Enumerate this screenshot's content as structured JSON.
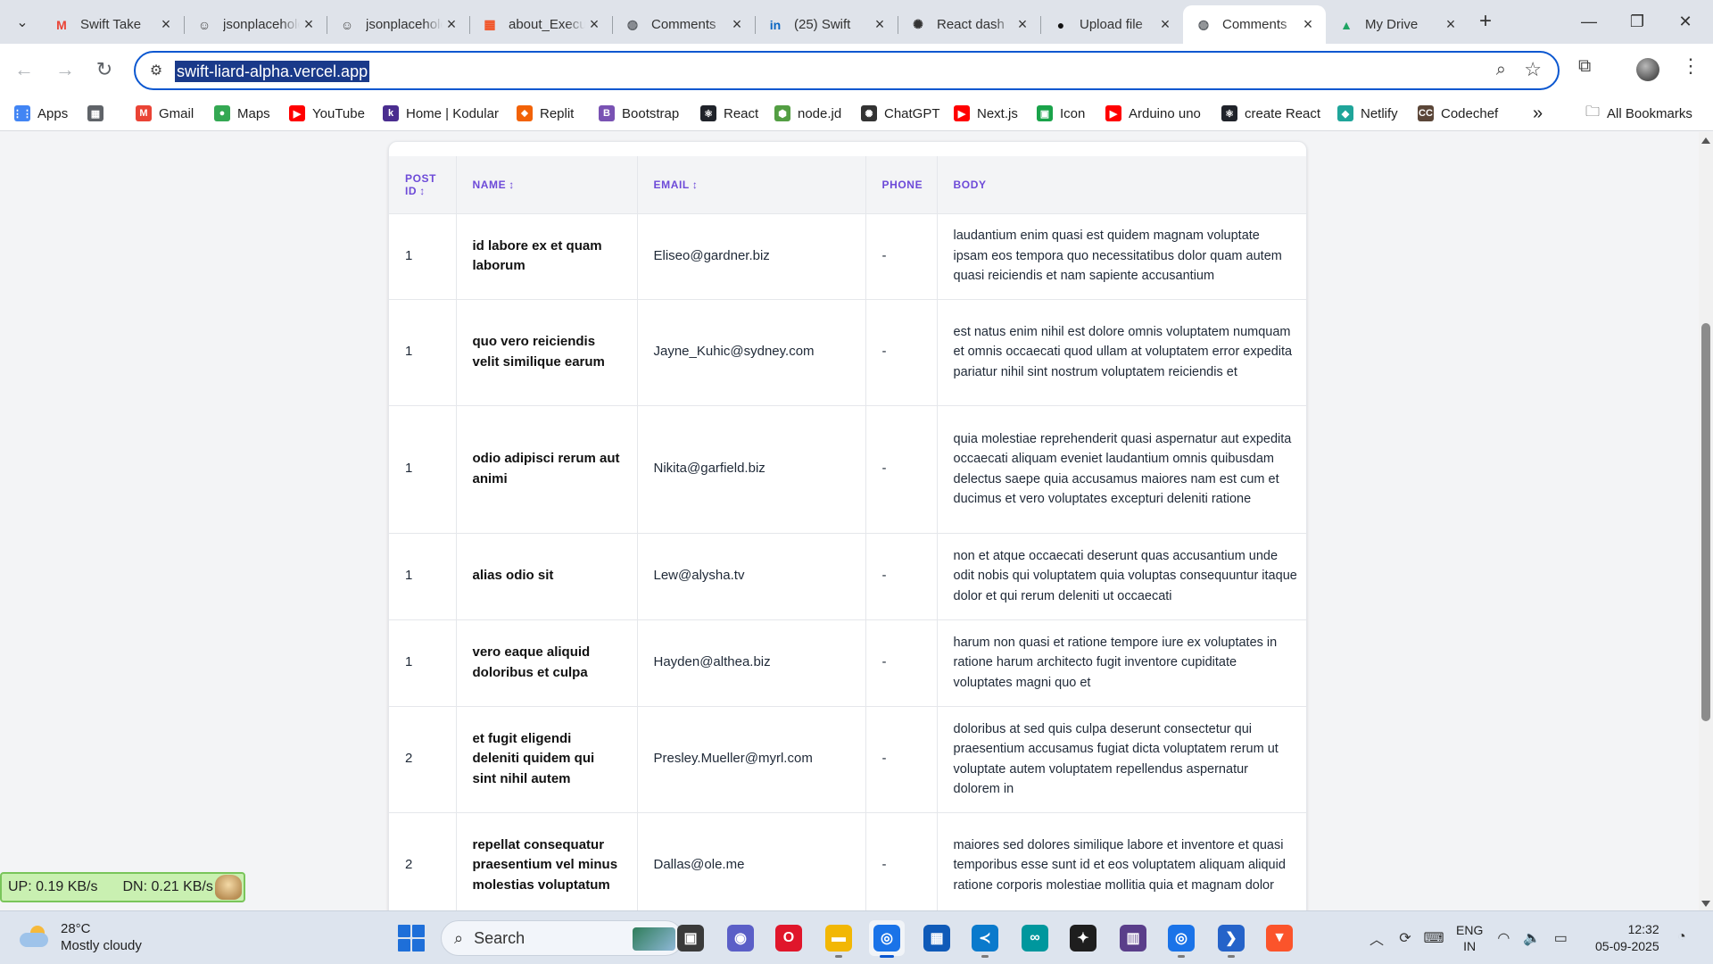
{
  "browser": {
    "tabs": [
      {
        "title": "Swift Take",
        "icon": "gmail-icon",
        "color": "#ea4335",
        "glyph": "M",
        "active": false
      },
      {
        "title": "jsonplaceholder",
        "icon": "jsonplaceholder-icon",
        "color": "#444444",
        "glyph": "☺",
        "active": false
      },
      {
        "title": "jsonplaceholder",
        "icon": "jsonplaceholder-icon",
        "color": "#444444",
        "glyph": "☺",
        "active": false
      },
      {
        "title": "about_Execution",
        "icon": "microsoft-icon",
        "color": "#f25022",
        "glyph": "▦",
        "active": false
      },
      {
        "title": "Comments",
        "icon": "globe-icon",
        "color": "#5f6368",
        "glyph": "◍",
        "active": false
      },
      {
        "title": "(25) Swift",
        "icon": "linkedin-icon",
        "color": "#0a66c2",
        "glyph": "in",
        "active": false
      },
      {
        "title": "React dash",
        "icon": "chatgpt-icon",
        "color": "#333333",
        "glyph": "✺",
        "active": false
      },
      {
        "title": "Upload file",
        "icon": "github-icon",
        "color": "#111111",
        "glyph": "●",
        "active": false
      },
      {
        "title": "Comments",
        "icon": "globe-icon",
        "color": "#5f6368",
        "glyph": "◍",
        "active": true
      },
      {
        "title": "My Drive",
        "icon": "google-drive-icon",
        "color": "#1fa463",
        "glyph": "▲",
        "active": false
      }
    ],
    "url": "swift-liard-alpha.vercel.app"
  },
  "bookmarks": [
    {
      "label": "Apps",
      "icon": "apps-grid-icon",
      "color": "#4285f4",
      "glyph": "⋮⋮"
    },
    {
      "label": "",
      "icon": "tab-groups-icon",
      "color": "#5f6368",
      "glyph": "▦"
    },
    {
      "label": "Gmail",
      "icon": "gmail-icon",
      "color": "#ea4335",
      "glyph": "M"
    },
    {
      "label": "Maps",
      "icon": "maps-pin-icon",
      "color": "#34a853",
      "glyph": "●"
    },
    {
      "label": "YouTube",
      "icon": "youtube-icon",
      "color": "#ff0000",
      "glyph": "▶"
    },
    {
      "label": "Home | Kodular",
      "icon": "kodular-icon",
      "color": "#4a2d8f",
      "glyph": "k"
    },
    {
      "label": "Replit",
      "icon": "replit-icon",
      "color": "#f26207",
      "glyph": "⬥"
    },
    {
      "label": "Bootstrap",
      "icon": "bootstrap-icon",
      "color": "#7952b3",
      "glyph": "B"
    },
    {
      "label": "React",
      "icon": "react-icon",
      "color": "#20232a",
      "glyph": "⚛"
    },
    {
      "label": "node.jd",
      "icon": "nodejs-icon",
      "color": "#539e43",
      "glyph": "⬢"
    },
    {
      "label": "ChatGPT",
      "icon": "chatgpt-icon",
      "color": "#333333",
      "glyph": "✺"
    },
    {
      "label": "Next.js",
      "icon": "youtube-icon",
      "color": "#ff0000",
      "glyph": "▶"
    },
    {
      "label": "Icon",
      "icon": "icon-site-icon",
      "color": "#1aa34a",
      "glyph": "▣"
    },
    {
      "label": "Arduino uno",
      "icon": "youtube-icon",
      "color": "#ff0000",
      "glyph": "▶"
    },
    {
      "label": "create React",
      "icon": "react-icon",
      "color": "#20232a",
      "glyph": "⚛"
    },
    {
      "label": "Netlify",
      "icon": "netlify-icon",
      "color": "#1fa59a",
      "glyph": "◆"
    },
    {
      "label": "Codechef",
      "icon": "codechef-icon",
      "color": "#5b4638",
      "glyph": "CC"
    }
  ],
  "bookmarks_more": "»",
  "all_bookmarks": "All Bookmarks",
  "table": {
    "headers": [
      {
        "label": "Post ID",
        "sortable": true
      },
      {
        "label": "Name",
        "sortable": true
      },
      {
        "label": "Email",
        "sortable": true
      },
      {
        "label": "Phone",
        "sortable": false
      },
      {
        "label": "Body",
        "sortable": false
      }
    ],
    "sort_glyph": "↕",
    "rows": [
      {
        "post_id": "1",
        "name": "id labore ex et quam laborum",
        "email": "Eliseo@gardner.biz",
        "phone": "-",
        "body": "laudantium enim quasi est quidem magnam voluptate ipsam eos tempora quo necessitatibus dolor quam autem quasi reiciendis et nam sapiente accusantium"
      },
      {
        "post_id": "1",
        "name": "quo vero reiciendis velit similique earum",
        "email": "Jayne_Kuhic@sydney.com",
        "phone": "-",
        "body": "est natus enim nihil est dolore omnis voluptatem numquam et omnis occaecati quod ullam at voluptatem error expedita pariatur nihil sint nostrum voluptatem reiciendis et"
      },
      {
        "post_id": "1",
        "name": "odio adipisci rerum aut animi",
        "email": "Nikita@garfield.biz",
        "phone": "-",
        "body": "quia molestiae reprehenderit quasi aspernatur aut expedita occaecati aliquam eveniet laudantium omnis quibusdam delectus saepe quia accusamus maiores nam est cum et ducimus et vero voluptates excepturi deleniti ratione"
      },
      {
        "post_id": "1",
        "name": "alias odio sit",
        "email": "Lew@alysha.tv",
        "phone": "-",
        "body": "non et atque occaecati deserunt quas accusantium unde odit nobis qui voluptatem quia voluptas consequuntur itaque dolor et qui rerum deleniti ut occaecati"
      },
      {
        "post_id": "1",
        "name": "vero eaque aliquid doloribus et culpa",
        "email": "Hayden@althea.biz",
        "phone": "-",
        "body": "harum non quasi et ratione tempore iure ex voluptates in ratione harum architecto fugit inventore cupiditate voluptates magni quo et"
      },
      {
        "post_id": "2",
        "name": "et fugit eligendi deleniti quidem qui sint nihil autem",
        "email": "Presley.Mueller@myrl.com",
        "phone": "-",
        "body": "doloribus at sed quis culpa deserunt consectetur qui praesentium accusamus fugiat dicta voluptatem rerum ut voluptate autem voluptatem repellendus aspernatur dolorem in"
      },
      {
        "post_id": "2",
        "name": "repellat consequatur praesentium vel minus molestias voluptatum",
        "email": "Dallas@ole.me",
        "phone": "-",
        "body": "maiores sed dolores similique labore et inventore et quasi temporibus esse sunt id et eos voluptatem aliquam aliquid ratione corporis molestiae mollitia quia et magnam dolor"
      }
    ]
  },
  "netspeed": {
    "up": "UP: 0.19 KB/s",
    "down": "DN: 0.21 KB/s"
  },
  "taskbar": {
    "weather_temp": "28°C",
    "weather_desc": "Mostly cloudy",
    "search_label": "Search",
    "apps": [
      {
        "name": "task-view-icon",
        "color": "#3a3a3a",
        "glyph": "▣",
        "active": false
      },
      {
        "name": "meet-now-icon",
        "color": "#5b5fc7",
        "glyph": "◉",
        "active": false
      },
      {
        "name": "opera-icon",
        "color": "#e0162b",
        "glyph": "O",
        "active": false
      },
      {
        "name": "file-explorer-icon",
        "color": "#f2b705",
        "glyph": "▬",
        "active": false,
        "running": true
      },
      {
        "name": "chrome-icon",
        "color": "#1a73e8",
        "glyph": "◎",
        "active": true,
        "running": true
      },
      {
        "name": "microsoft-store-icon",
        "color": "#0f5ab8",
        "glyph": "▦",
        "active": false
      },
      {
        "name": "vscode-icon",
        "color": "#0a7acc",
        "glyph": "≺",
        "active": false,
        "running": true
      },
      {
        "name": "arduino-icon",
        "color": "#00979d",
        "glyph": "∞",
        "active": false
      },
      {
        "name": "figma-icon",
        "color": "#1e1e1e",
        "glyph": "✦",
        "active": false
      },
      {
        "name": "winrar-icon",
        "color": "#5a3e8a",
        "glyph": "▥",
        "active": false
      },
      {
        "name": "chrome-icon",
        "color": "#1a73e8",
        "glyph": "◎",
        "active": false,
        "running": true
      },
      {
        "name": "powershell-icon",
        "color": "#2563c9",
        "glyph": "❯",
        "active": false,
        "running": true
      },
      {
        "name": "brave-icon",
        "color": "#fb542b",
        "glyph": "▼",
        "active": false
      }
    ],
    "lang_top": "ENG",
    "lang_bottom": "IN",
    "time": "12:32",
    "date": "05-09-2025"
  }
}
